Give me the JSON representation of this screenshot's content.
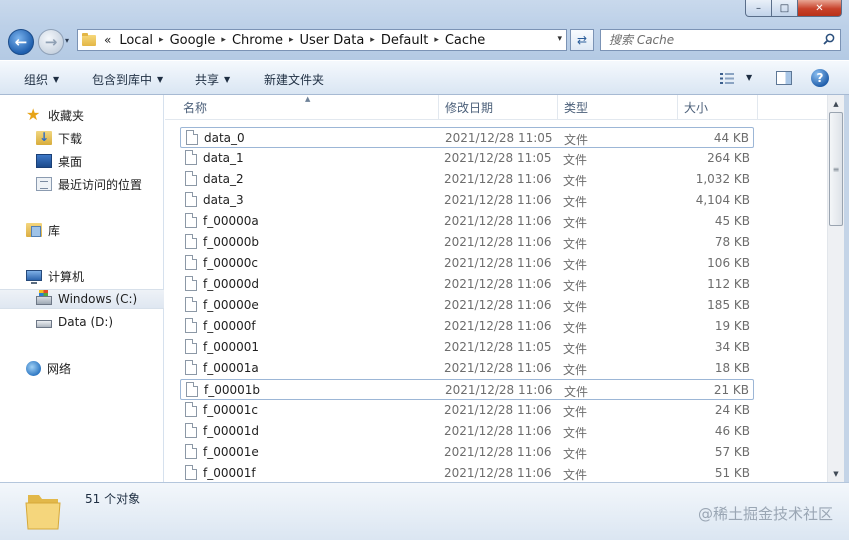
{
  "window": {
    "controls": {
      "minimize": "–",
      "maximize": "□",
      "close": "✕"
    }
  },
  "nav": {
    "back_icon": "left-arrow-icon",
    "forward_icon": "right-arrow-icon",
    "back_glyph": "←",
    "forward_glyph": "→",
    "history_dropdown": "▾"
  },
  "address": {
    "overflow": "«",
    "crumbs": [
      "Local",
      "Google",
      "Chrome",
      "User Data",
      "Default",
      "Cache"
    ],
    "separator": "▸",
    "dropdown": "▾",
    "refresh_glyph": "⇄"
  },
  "search": {
    "placeholder": "搜索 Cache"
  },
  "toolbar": {
    "organize": "组织",
    "include_in_library": "包含到库中",
    "share": "共享",
    "new_folder": "新建文件夹",
    "help": "?"
  },
  "navpane": {
    "favorites": "收藏夹",
    "downloads": "下载",
    "desktop": "桌面",
    "recent": "最近访问的位置",
    "libraries": "库",
    "computer": "计算机",
    "drive_c": "Windows (C:)",
    "drive_d": "Data (D:)",
    "network": "网络"
  },
  "columns": {
    "name": "名称",
    "date": "修改日期",
    "type": "类型",
    "size": "大小",
    "sort_indicator": "▲"
  },
  "files": [
    {
      "name": "data_0",
      "date": "2021/12/28 11:05",
      "type": "文件",
      "size": "44 KB"
    },
    {
      "name": "data_1",
      "date": "2021/12/28 11:05",
      "type": "文件",
      "size": "264 KB"
    },
    {
      "name": "data_2",
      "date": "2021/12/28 11:06",
      "type": "文件",
      "size": "1,032 KB"
    },
    {
      "name": "data_3",
      "date": "2021/12/28 11:06",
      "type": "文件",
      "size": "4,104 KB"
    },
    {
      "name": "f_00000a",
      "date": "2021/12/28 11:06",
      "type": "文件",
      "size": "45 KB"
    },
    {
      "name": "f_00000b",
      "date": "2021/12/28 11:06",
      "type": "文件",
      "size": "78 KB"
    },
    {
      "name": "f_00000c",
      "date": "2021/12/28 11:06",
      "type": "文件",
      "size": "106 KB"
    },
    {
      "name": "f_00000d",
      "date": "2021/12/28 11:06",
      "type": "文件",
      "size": "112 KB"
    },
    {
      "name": "f_00000e",
      "date": "2021/12/28 11:06",
      "type": "文件",
      "size": "185 KB"
    },
    {
      "name": "f_00000f",
      "date": "2021/12/28 11:06",
      "type": "文件",
      "size": "19 KB"
    },
    {
      "name": "f_000001",
      "date": "2021/12/28 11:05",
      "type": "文件",
      "size": "34 KB"
    },
    {
      "name": "f_00001a",
      "date": "2021/12/28 11:06",
      "type": "文件",
      "size": "18 KB"
    },
    {
      "name": "f_00001b",
      "date": "2021/12/28 11:06",
      "type": "文件",
      "size": "21 KB"
    },
    {
      "name": "f_00001c",
      "date": "2021/12/28 11:06",
      "type": "文件",
      "size": "24 KB"
    },
    {
      "name": "f_00001d",
      "date": "2021/12/28 11:06",
      "type": "文件",
      "size": "46 KB"
    },
    {
      "name": "f_00001e",
      "date": "2021/12/28 11:06",
      "type": "文件",
      "size": "57 KB"
    },
    {
      "name": "f_00001f",
      "date": "2021/12/28 11:06",
      "type": "文件",
      "size": "51 KB"
    }
  ],
  "highlighted_rows": [
    0,
    12
  ],
  "scrollbar": {
    "up": "▲",
    "down": "▼",
    "grip": "≡"
  },
  "status": {
    "item_count": "51 个对象"
  },
  "watermark": "@稀土掘金技术社区",
  "colors": {
    "accent": "#1f5fae",
    "row_hover_border": "#9cb6d6",
    "secondary_text": "#6d6d6d"
  }
}
